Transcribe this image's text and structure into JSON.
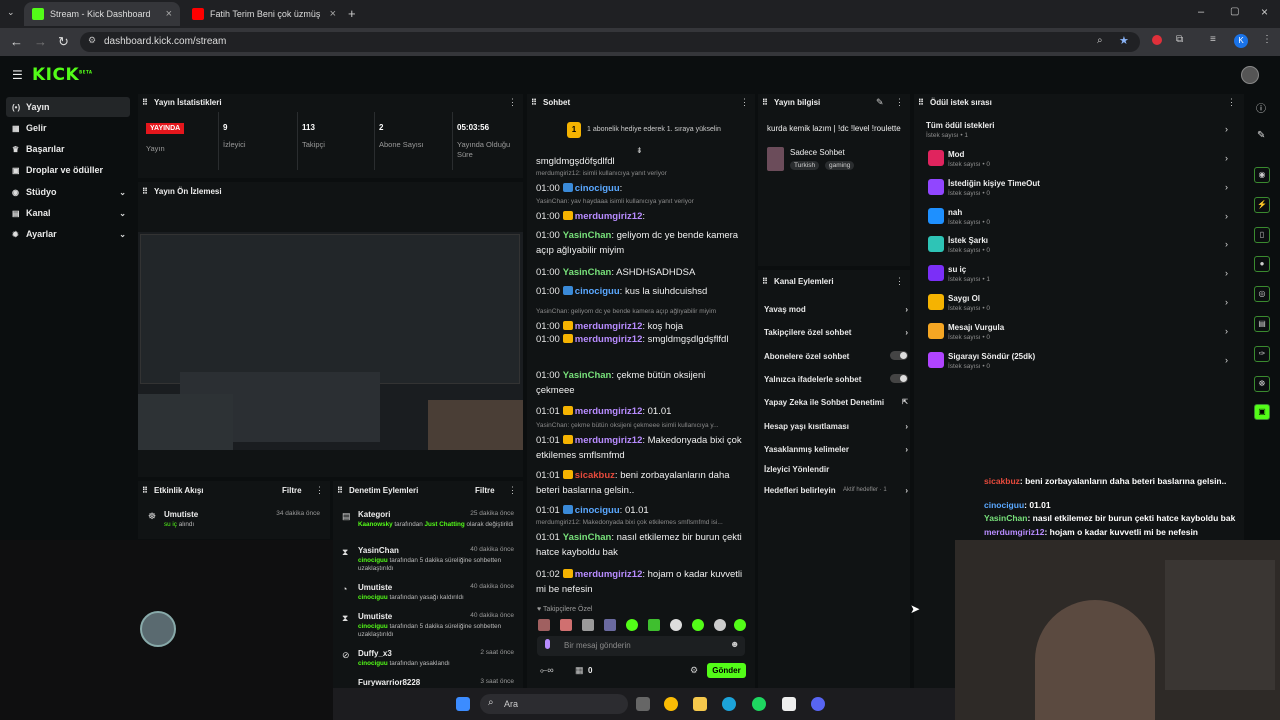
{
  "browser": {
    "tabs": [
      {
        "title": "Stream - Kick Dashboard",
        "active": true
      },
      {
        "title": "Fatih Terim Beni çok üzmüş olar",
        "active": false
      }
    ],
    "url": "dashboard.kick.com/stream",
    "new_tab": "+"
  },
  "kick": {
    "logo": "KICK",
    "logo_sup": "BETA",
    "avatar_initial": "K"
  },
  "sidebar": {
    "items": [
      {
        "label": "Yayın",
        "icon": "radio-icon"
      },
      {
        "label": "Gelir",
        "icon": "revenue-icon"
      },
      {
        "label": "Başarılar",
        "icon": "trophy-icon"
      },
      {
        "label": "Droplar ve ödüller",
        "icon": "gift-icon"
      },
      {
        "label": "Stüdyo",
        "icon": "camera-icon"
      },
      {
        "label": "Kanal",
        "icon": "channel-icon"
      },
      {
        "label": "Ayarlar",
        "icon": "gear-icon"
      }
    ]
  },
  "stats": {
    "title": "Yayın İstatistikleri",
    "status": "YAYINDA",
    "status_label": "Yayın",
    "viewers": "9",
    "viewers_label": "İzleyici",
    "followers": "113",
    "followers_label": "Takipçi",
    "subs": "2",
    "subs_label": "Abone Sayısı",
    "uptime": "05:03:56",
    "uptime_label": "Yayında Olduğu Süre"
  },
  "preview": {
    "title": "Yayın Ön İzlemesi"
  },
  "activity": {
    "title": "Etkinlik Akışı",
    "filter": "Filtre",
    "items": [
      {
        "name": "Umutiste",
        "time": "34 dakika önce",
        "action": "su iç",
        "suffix": "alındı"
      }
    ]
  },
  "moderation": {
    "title": "Denetim Eylemleri",
    "filter": "Filtre",
    "items": [
      {
        "name": "Kategori",
        "time": "25 dakika önce",
        "actor": "Kaanowsky",
        "desc": "tarafından",
        "target": "Just Chatting",
        "rest": "olarak değiştirildi"
      },
      {
        "name": "YasinChan",
        "time": "40 dakika önce",
        "actor": "cinociguu",
        "desc": "tarafından 5 dakika süreliğine sohbetten uzaklaştırıldı"
      },
      {
        "name": "Umutiste",
        "time": "40 dakika önce",
        "actor": "cinociguu",
        "desc": "tarafından yasağı kaldırıldı"
      },
      {
        "name": "Umutiste",
        "time": "40 dakika önce",
        "actor": "cinociguu",
        "desc": "tarafından 5 dakika süreliğine sohbetten uzaklaştırıldı"
      },
      {
        "name": "Duffy_x3",
        "time": "2 saat önce",
        "actor": "cinociguu",
        "desc": "tarafından yasaklandı"
      },
      {
        "name": "Furywarrior8228",
        "time": "3 saat önce",
        "actor": "",
        "desc": ""
      }
    ]
  },
  "chat": {
    "title": "Sohbet",
    "pinned": "1 abonelik hediye ederek 1. sıraya yükselin",
    "first_line": "smgldmgşdöfşdlfdl",
    "lines": [
      {
        "reply": "merdumgiriz12: isimli kullanıcıya yanıt veriyor",
        "time": "01:00",
        "user": "cinociguu",
        "cls": "u-blue",
        "msg": ""
      },
      {
        "reply": "YasinChan: yav haydaaa isimli kullanıcıya yanıt veriyor",
        "time": "01:00",
        "user": "merdumgiriz12",
        "cls": "u-purple",
        "msg": ""
      },
      {
        "time": "01:00",
        "user": "YasinChan",
        "cls": "u-green",
        "msg": "geliyom dc ye bende kamera açıp ağlıyabilir miyim"
      },
      {
        "time": "01:00",
        "user": "YasinChan",
        "cls": "u-green",
        "msg": "ASHDHSADHDSA"
      },
      {
        "time": "01:00",
        "user": "cinociguu",
        "cls": "u-blue",
        "msg": "kus la siuhdcuishsd"
      },
      {
        "reply": "YasinChan: geliyom dc ye bende kamera açıp ağlıyabilir miyim",
        "time": "01:00",
        "user": "merdumgiriz12",
        "cls": "u-purple",
        "msg": "koş hoja"
      },
      {
        "time": "01:00",
        "user": "merdumgiriz12",
        "cls": "u-purple",
        "msg": "smgldmgşdlgdşflfdl"
      },
      {
        "time": "01:00",
        "user": "YasinChan",
        "cls": "u-green",
        "msg": "çekme bütün oksijeni çekmeee"
      },
      {
        "time": "01:01",
        "user": "merdumgiriz12",
        "cls": "u-purple",
        "msg": "01.01"
      },
      {
        "reply": "YasinChan: çekme bütün oksijeni çekmeee isimli kullanıcıya y...",
        "time": "01:01",
        "user": "merdumgiriz12",
        "cls": "u-purple",
        "msg": "Makedonyada bixi çok etkilemes smflsmfmd"
      },
      {
        "time": "01:01",
        "user": "sicakbuz",
        "cls": "u-red",
        "msg": "beni zorbayalanların daha beteri baslarına gelsin.."
      },
      {
        "time": "01:01",
        "user": "cinociguu",
        "cls": "u-blue",
        "msg": "01.01"
      },
      {
        "reply": "merdumgiriz12: Makedonyada bixi çok etkilemes smflsmfmd isi...",
        "time": "01:01",
        "user": "YasinChan",
        "cls": "u-green",
        "msg": "nasıl etkilemez bir burun çekti hatce kayboldu bak"
      },
      {
        "time": "01:02",
        "user": "merdumgiriz12",
        "cls": "u-purple",
        "msg": "hojam o kadar kuvvetli mi be nefesin"
      }
    ],
    "followers_only": "Takipçilere Özel",
    "input_placeholder": "Bir mesaj gönderin",
    "points": "0",
    "send": "Gönder"
  },
  "stream_info": {
    "title": "Yayın bilgisi",
    "stream_title": "kurda kemik lazım | !dc !level !roulette",
    "category": "Sadece Sohbet",
    "tags": [
      "Turkish",
      "gaming"
    ]
  },
  "channel_actions": {
    "title": "Kanal Eylemleri",
    "items": [
      {
        "label": "Yavaş mod",
        "type": "chev"
      },
      {
        "label": "Takipçilere özel sohbet",
        "type": "chev"
      },
      {
        "label": "Abonelere özel sohbet",
        "type": "toggle"
      },
      {
        "label": "Yalnızca ifadelerle sohbet",
        "type": "toggle"
      },
      {
        "label": "Yapay Zeka ile Sohbet Denetimi",
        "type": "ext"
      },
      {
        "label": "Hesap yaşı kısıtlaması",
        "type": "chev"
      },
      {
        "label": "Yasaklanmış kelimeler",
        "type": "chev"
      },
      {
        "label": "İzleyici Yönlendir",
        "type": "none"
      },
      {
        "label": "Hedefleri belirleyin",
        "type": "chev",
        "note": "Aktif hedefler · 1"
      }
    ]
  },
  "rewards": {
    "title": "Ödül istek sırası",
    "all": "Tüm ödül istekleri",
    "all_sub": "İstek sayısı • 1",
    "items": [
      {
        "name": "Mod",
        "sub": "İstek sayısı • 0",
        "color": "#e0245e"
      },
      {
        "name": "İstediğin kişiye TimeOut",
        "sub": "İstek sayısı • 0",
        "color": "#9146ff"
      },
      {
        "name": "nah",
        "sub": "İstek sayısı • 0",
        "color": "#1e90ff"
      },
      {
        "name": "İstek Şarkı",
        "sub": "İstek sayısı • 0",
        "color": "#2ec4b6"
      },
      {
        "name": "su iç",
        "sub": "İstek sayısı • 1",
        "color": "#7b2ff7"
      },
      {
        "name": "Saygı Ol",
        "sub": "İstek sayısı • 0",
        "color": "#f5b301"
      },
      {
        "name": "Mesajı Vurgula",
        "sub": "İstek sayısı • 0",
        "color": "#f5a623"
      },
      {
        "name": "Sigarayı Söndür (25dk)",
        "sub": "İstek sayısı • 0",
        "color": "#b044ff"
      }
    ]
  },
  "overlay_chat": [
    {
      "user": "sicakbuz",
      "msg": "beni zorbayalanların daha beteri baslarına gelsin.."
    },
    {
      "user": "cinociguu",
      "msg": "01.01"
    },
    {
      "user": "YasinChan",
      "msg": "nasıl etkilemez bir burun çekti hatce kayboldu bak"
    },
    {
      "user": "merdumgiriz12",
      "msg": "hojam o kadar kuvvetli mi be nefesin"
    }
  ],
  "taskbar": {
    "search": "Ara"
  },
  "colors": {
    "accent": "#53fc18",
    "live": "#e5161c",
    "panel": "#101314",
    "bg": "#0b0e0f"
  }
}
